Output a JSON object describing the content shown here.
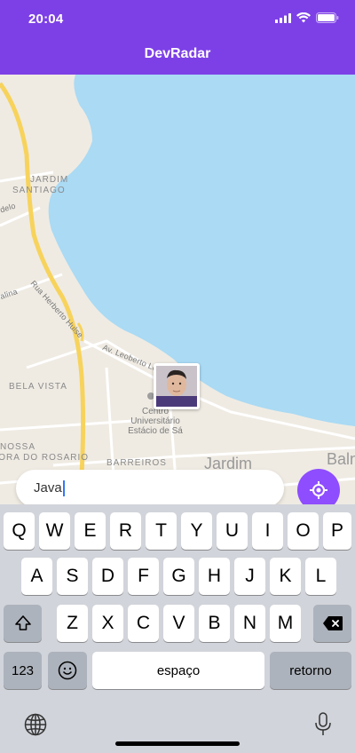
{
  "status_bar": {
    "time": "20:04"
  },
  "app": {
    "title": "DevRadar"
  },
  "map": {
    "labels": {
      "jardim": "JARDIM",
      "santiago": "SANTIAGO",
      "delo": "delo",
      "street_herbert": "Rua Herberto Hulse",
      "alina": "alina",
      "leoberto": "Av. Leoberto Le...",
      "bela_vista": "BELA VISTA",
      "nossa": "NOSSA",
      "rosario": "HORA DO ROSARIO",
      "barreiros": "BARREIROS",
      "jardim2": "Jardim",
      "balneario": "Baln"
    },
    "poi": {
      "line1": "Centro",
      "line2": "Universitário",
      "line3": "Estácio de Sá"
    }
  },
  "search": {
    "value": "Java"
  },
  "keyboard": {
    "row1": [
      "Q",
      "W",
      "E",
      "R",
      "T",
      "Y",
      "U",
      "I",
      "O",
      "P"
    ],
    "row2": [
      "A",
      "S",
      "D",
      "F",
      "G",
      "H",
      "J",
      "K",
      "L"
    ],
    "row3": [
      "Z",
      "X",
      "C",
      "V",
      "B",
      "N",
      "M"
    ],
    "num_key": "123",
    "space_key": "espaço",
    "return_key": "retorno"
  }
}
